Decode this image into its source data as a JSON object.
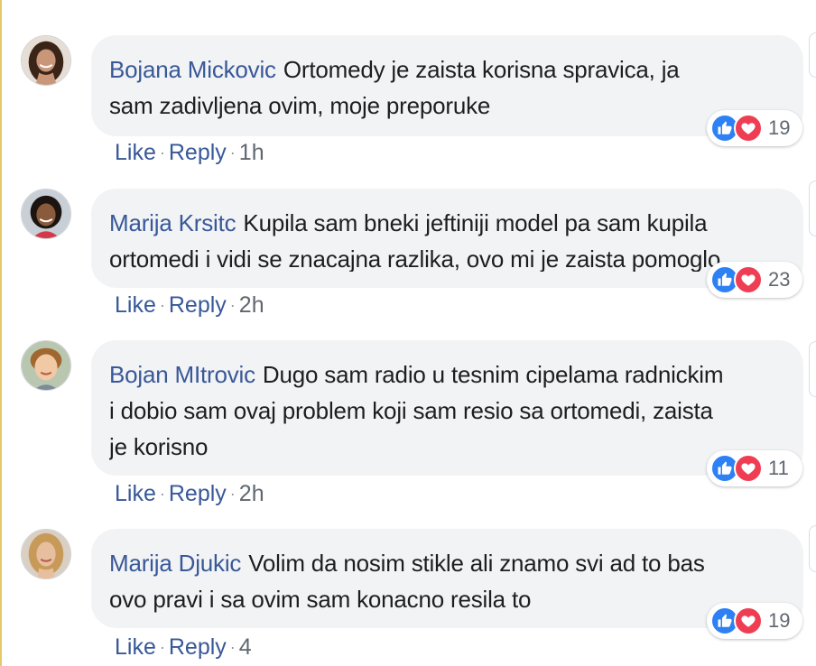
{
  "comments": [
    {
      "author": "Bojana Mickovic",
      "lines": [
        "Ortomedy je zaista korisna spravica, ja",
        "sam zadivljena ovim, moje preporuke"
      ],
      "reaction_count": "19",
      "like_label": "Like",
      "reply_label": "Reply",
      "time": "1h"
    },
    {
      "author": "Marija Krsitc",
      "lines": [
        "Kupila sam bneki jeftiniji model pa sam kupila",
        "ortomedi i vidi se znacajna razlika, ovo mi je zaista pomoglo"
      ],
      "reaction_count": "23",
      "like_label": "Like",
      "reply_label": "Reply",
      "time": "2h"
    },
    {
      "author": "Bojan MItrovic",
      "lines": [
        "Dugo sam radio u tesnim cipelama radnickim",
        "i dobio sam ovaj problem koji sam resio sa ortomedi, zaista",
        "je korisno"
      ],
      "reaction_count": "11",
      "like_label": "Like",
      "reply_label": "Reply",
      "time": "2h"
    },
    {
      "author": "Marija Djukic",
      "lines": [
        "Volim da nosim stikle ali znamo svi ad to bas",
        "ovo pravi i sa ovim sam konacno resila to"
      ],
      "reaction_count": "19",
      "like_label": "Like",
      "reply_label": "Reply",
      "time": "4"
    }
  ],
  "separator": "·",
  "icons": {
    "like": "thumbs-up-icon",
    "love": "heart-icon"
  },
  "colors": {
    "author": "#385898",
    "bubble": "#f2f3f5",
    "like_blue": "#2e80f5",
    "love_red": "#ef3e53"
  }
}
